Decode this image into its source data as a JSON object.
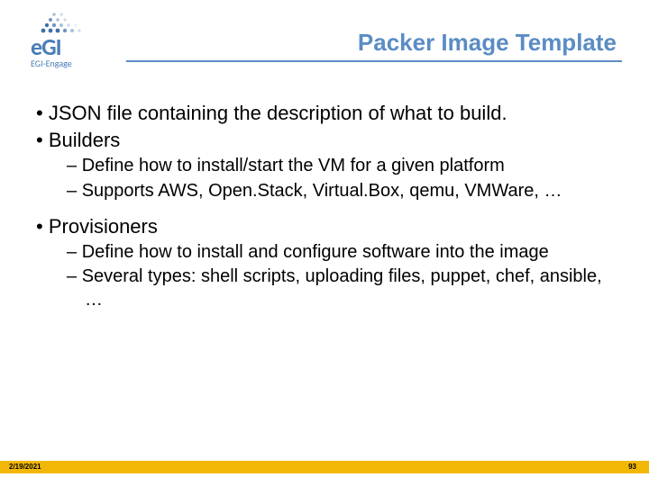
{
  "logo": {
    "text": "eGI",
    "sub": "EGI-Engage"
  },
  "title": "Packer Image Template",
  "bullets": {
    "b1_1": "JSON file containing the description of what to build.",
    "b1_2": "Builders",
    "b2_1": "Define how to install/start the VM for a given platform",
    "b2_2": "Supports AWS, Open.Stack, Virtual.Box, qemu, VMWare, …",
    "b1_3": "Provisioners",
    "b2_3": "Define how to install and configure software into the image",
    "b2_4": "Several types: shell scripts, uploading files, puppet, chef, ansible, …"
  },
  "footer": {
    "date": "2/19/2021",
    "page": "93"
  }
}
